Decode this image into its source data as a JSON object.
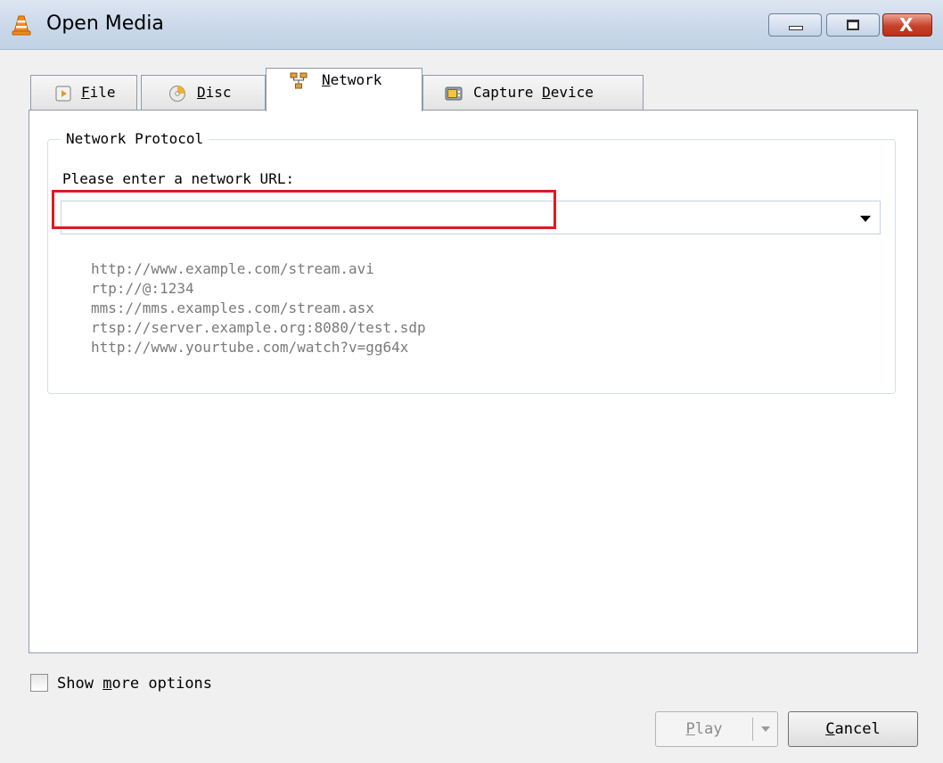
{
  "window": {
    "title": "Open Media",
    "icon": "vlc-cone-icon",
    "minimize_icon": "minimize-icon",
    "maximize_icon": "maximize-icon",
    "close_glyph": "X"
  },
  "tabs": [
    {
      "key": "F",
      "rest": "ile",
      "icon": "file-play-icon",
      "active": false
    },
    {
      "key": "D",
      "rest": "isc",
      "icon": "disc-icon",
      "active": false
    },
    {
      "key": "N",
      "rest": "etwork",
      "icon": "network-icon",
      "active": true
    },
    {
      "prefix": "Capture ",
      "key": "D",
      "rest": "evice",
      "icon": "capture-device-icon",
      "active": false
    }
  ],
  "network": {
    "group_title": "Network Protocol",
    "prompt": "Please enter a network URL:",
    "url_value": "",
    "examples": [
      "http://www.example.com/stream.avi",
      "rtp://@:1234",
      "mms://mms.examples.com/stream.asx",
      "rtsp://server.example.org:8080/test.sdp",
      "http://www.yourtube.com/watch?v=gg64x"
    ]
  },
  "options": {
    "show_more_prefix": "Show ",
    "show_more_key": "m",
    "show_more_rest": "ore options",
    "checked": false
  },
  "buttons": {
    "play_key": "P",
    "play_rest": "lay",
    "play_enabled": false,
    "cancel_key": "C",
    "cancel_rest": "ancel"
  },
  "colors": {
    "highlight": "#e0191f",
    "example_text": "#7a7a7a",
    "titlebar": "#c9d7e9"
  }
}
